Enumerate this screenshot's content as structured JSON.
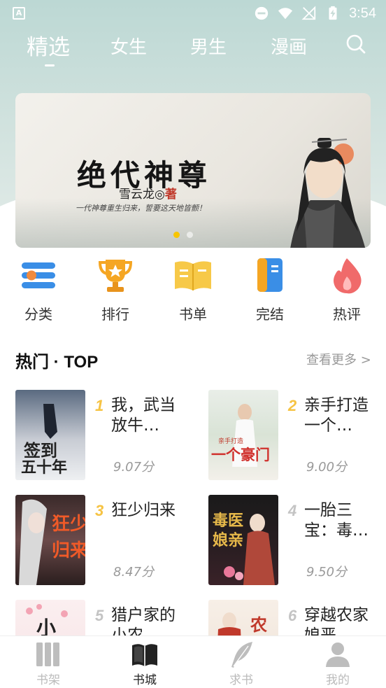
{
  "status": {
    "time": "3:54",
    "left_icon": "A"
  },
  "tabs": [
    {
      "label": "精选",
      "active": true
    },
    {
      "label": "女生"
    },
    {
      "label": "男生"
    },
    {
      "label": "漫画"
    }
  ],
  "banner": {
    "title": "绝代神尊",
    "author_name": "雪云龙◎",
    "author_suffix": "著",
    "slogan": "一代神尊重生归来，誓要这天地皆颤！",
    "active_dot": 1,
    "dot_count": 2
  },
  "categories": [
    {
      "label": "分类",
      "icon": "category-icon"
    },
    {
      "label": "排行",
      "icon": "trophy-icon"
    },
    {
      "label": "书单",
      "icon": "open-book-icon"
    },
    {
      "label": "完结",
      "icon": "finished-book-icon"
    },
    {
      "label": "热评",
      "icon": "flame-icon"
    }
  ],
  "section": {
    "title": "热门 · TOP",
    "more": "查看更多 >"
  },
  "books": [
    {
      "rank": "1",
      "title": "我，武当放牛…",
      "score": "9.07分",
      "cover_text": "签到五十年"
    },
    {
      "rank": "2",
      "title": "亲手打造一个…",
      "score": "9.00分",
      "cover_text": "一个豪门"
    },
    {
      "rank": "3",
      "title": "狂少归来",
      "score": "8.47分",
      "cover_text": "狂少归来"
    },
    {
      "rank": "4",
      "title": "一胎三宝：毒…",
      "score": "9.50分",
      "cover_text": "毒医娘亲"
    },
    {
      "rank": "5",
      "title": "猎户家的小农…",
      "score": "",
      "cover_text": "小"
    },
    {
      "rank": "6",
      "title": "穿越农家娘恶…",
      "score": "",
      "cover_text": "农"
    }
  ],
  "nav": [
    {
      "label": "书架",
      "icon": "bookshelf-icon"
    },
    {
      "label": "书城",
      "icon": "bookstore-icon",
      "active": true
    },
    {
      "label": "求书",
      "icon": "feather-icon"
    },
    {
      "label": "我的",
      "icon": "user-icon"
    }
  ],
  "colors": {
    "accent": "#f7c500",
    "rank_gold": "#f6c343",
    "rank_gray": "#c4c4c4"
  }
}
